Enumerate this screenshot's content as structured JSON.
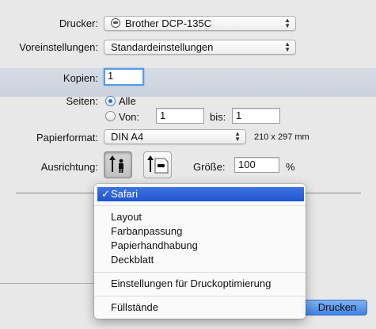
{
  "labels": {
    "drucker": "Drucker:",
    "voreinstellungen": "Voreinstellungen:",
    "kopien": "Kopien:",
    "seiten": "Seiten:",
    "papierformat": "Papierformat:",
    "ausrichtung": "Ausrichtung:",
    "groesse": "Größe:"
  },
  "printer": {
    "value": "Brother DCP-135C"
  },
  "presets": {
    "value": "Standardeinstellungen"
  },
  "copies": {
    "value": "1"
  },
  "pages": {
    "all_label": "Alle",
    "from_label": "Von:",
    "from_value": "1",
    "to_label": "bis:",
    "to_value": "1"
  },
  "paper": {
    "value": "DIN A4",
    "dimensions": "210 x 297 mm"
  },
  "scale": {
    "value": "100",
    "unit": "%"
  },
  "menu": {
    "selected": "Safari",
    "check": "✓",
    "items": [
      "Layout",
      "Farbanpassung",
      "Papierhandhabung",
      "Deckblatt"
    ],
    "optimization": "Einstellungen für Druckoptimierung",
    "levels": "Füllstände"
  },
  "buttons": {
    "print": "Drucken"
  }
}
